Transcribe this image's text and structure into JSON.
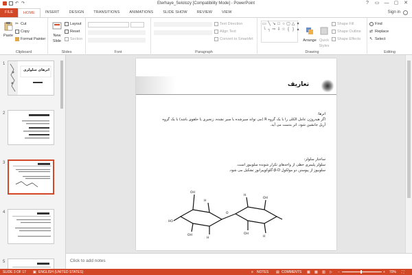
{
  "window": {
    "title": "Eterhaye_Selolozy [Compatibility Mode] - PowerPoint",
    "controls": [
      "?",
      "▭",
      "—",
      "▢",
      "✕"
    ]
  },
  "tabs": [
    "FILE",
    "HOME",
    "INSERT",
    "DESIGN",
    "TRANSITIONS",
    "ANIMATIONS",
    "SLIDE SHOW",
    "REVIEW",
    "VIEW"
  ],
  "active_tab": "HOME",
  "account": {
    "sign_in": "Sign in"
  },
  "ribbon": {
    "clipboard": {
      "label": "Clipboard",
      "paste": "Paste",
      "cut": "Cut",
      "copy": "Copy",
      "format_painter": "Format Painter"
    },
    "slides": {
      "label": "Slides",
      "new_slide_1": "New",
      "new_slide_2": "Slide",
      "layout": "Layout",
      "reset": "Reset",
      "section": "Section"
    },
    "font": {
      "label": "Font"
    },
    "paragraph": {
      "label": "Paragraph",
      "text_direction": "Text Direction",
      "align_text": "Align Text",
      "convert_smartart": "Convert to SmartArt"
    },
    "drawing": {
      "label": "Drawing",
      "arrange": "Arrange",
      "quick_styles_1": "Quick",
      "quick_styles_2": "Styles",
      "shape_fill": "Shape Fill",
      "shape_outline": "Shape Outline",
      "shape_effects": "Shape Effects"
    },
    "editing": {
      "label": "Editing",
      "find": "Find",
      "replace": "Replace",
      "select": "Select"
    }
  },
  "thumbnails": [
    {
      "num": "1",
      "title": "اترهای سلولزی"
    },
    {
      "num": "2"
    },
    {
      "num": "3"
    },
    {
      "num": "4"
    },
    {
      "num": "5"
    }
  ],
  "selected_slide": 3,
  "slide": {
    "title": "تعاریف",
    "p1_head": "اترها:",
    "p1_body": "اگر هیدروژن عامل الکلی را با یک گروه R (می تواند سیرشده یا سیر نشده، زنجیری یا حلقوی باشد) با یک گروه آریل جانشین شود، اتر بدست می آید.",
    "p2_head": "ساختار سلولز:",
    "p2_l1": "سلولز پلیمری خطی از واحدهای تکرار شونده سلوبیوز است.",
    "p2_l2": "سلوبیوز از پیوستن دو مولکول β-D-گلوکوپیرانوز تشکیل می شود."
  },
  "notes": {
    "placeholder": "Click to add notes"
  },
  "status": {
    "slide_counter": "SLIDE 3 OF 17",
    "language": "ENGLISH (UNITED STATES)",
    "notes": "NOTES",
    "comments": "COMMENTS",
    "zoom": "70%"
  }
}
